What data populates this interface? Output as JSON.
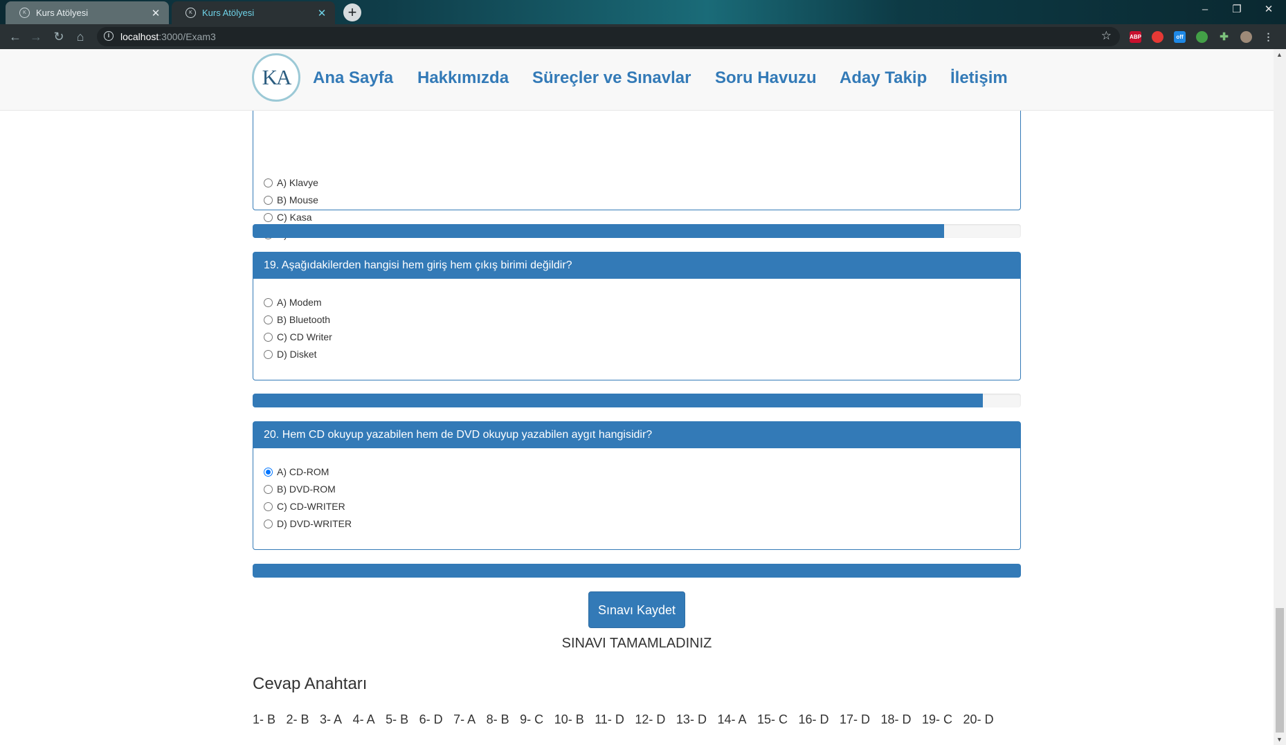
{
  "browser": {
    "tabs": [
      {
        "title": "Kurs Atölyesi",
        "active": false
      },
      {
        "title": "Kurs Atölyesi",
        "active": true
      }
    ],
    "new_tab": "+",
    "url_host": "localhost",
    "url_path": ":3000/Exam3",
    "extension_abp": "ABP",
    "extension_off": "off"
  },
  "navbar": {
    "logo_text": "KA",
    "links": [
      "Ana Sayfa",
      "Hakkımızda",
      "Süreçler ve Sınavlar",
      "Soru Havuzu",
      "Aday Takip",
      "İletişim"
    ]
  },
  "questions": [
    {
      "title": "",
      "options": [
        "A) Klavye",
        "B) Mouse",
        "C) Kasa",
        "D) Windows"
      ],
      "selected": null
    },
    {
      "title": "19. Aşağıdakilerden hangisi hem giriş hem çıkış birimi değildir?",
      "options": [
        "A) Modem",
        "B) Bluetooth",
        "C) CD Writer",
        "D) Disket"
      ],
      "selected": null
    },
    {
      "title": "20. Hem CD okuyup yazabilen hem de DVD okuyup yazabilen aygıt hangisidir?",
      "options": [
        "A) CD-ROM",
        "B) DVD-ROM",
        "C) CD-WRITER",
        "D) DVD-WRITER"
      ],
      "selected": 0
    }
  ],
  "progress": [
    0.9,
    0.95,
    1.0
  ],
  "save_button": "Sınavı Kaydet",
  "completed_message": "SINAVI TAMAMLADINIZ",
  "answer_key": {
    "title": "Cevap Anahtarı",
    "answers": [
      "1- B",
      "2- B",
      "3- A",
      "4- A",
      "5- B",
      "6- D",
      "7- A",
      "8- B",
      "9- C",
      "10- B",
      "11- D",
      "12- D",
      "13- D",
      "14- A",
      "15- C",
      "16- D",
      "17- D",
      "18- D",
      "19- C",
      "20- D"
    ]
  },
  "colors": {
    "primary": "#337ab7",
    "radio_checked": "#0075ff"
  }
}
